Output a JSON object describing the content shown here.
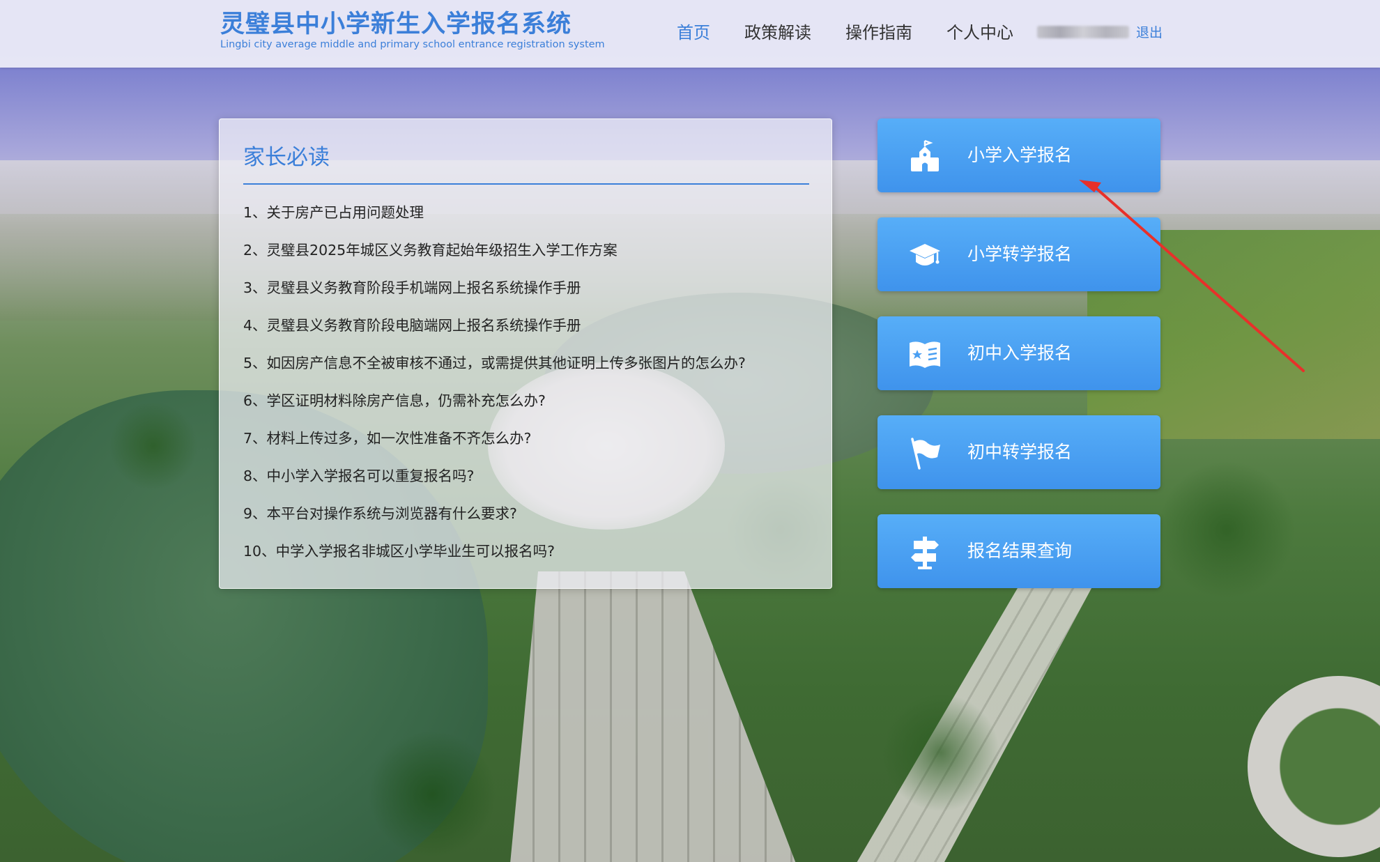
{
  "header": {
    "title_cn": "灵璧县中小学新生入学报名系统",
    "title_en": "Lingbi city average middle and primary school entrance registration system",
    "nav": [
      {
        "label": "首页",
        "active": true
      },
      {
        "label": "政策解读",
        "active": false
      },
      {
        "label": "操作指南",
        "active": false
      },
      {
        "label": "个人中心",
        "active": false
      }
    ],
    "logout_label": "退出"
  },
  "notice": {
    "title": "家长必读",
    "items": [
      "1、关于房产已占用问题处理",
      "2、灵璧县2025年城区义务教育起始年级招生入学工作方案",
      "3、灵璧县义务教育阶段手机端网上报名系统操作手册",
      "4、灵璧县义务教育阶段电脑端网上报名系统操作手册",
      "5、如因房产信息不全被审核不通过，或需提供其他证明上传多张图片的怎么办?",
      "6、学区证明材料除房产信息，仍需补充怎么办?",
      "7、材料上传过多，如一次性准备不齐怎么办?",
      "8、中小学入学报名可以重复报名吗?",
      "9、本平台对操作系统与浏览器有什么要求?",
      "10、中学入学报名非城区小学毕业生可以报名吗?"
    ]
  },
  "actions": [
    {
      "label": "小学入学报名",
      "icon": "school-icon"
    },
    {
      "label": "小学转学报名",
      "icon": "graduation-cap-icon"
    },
    {
      "label": "初中入学报名",
      "icon": "book-star-icon"
    },
    {
      "label": "初中转学报名",
      "icon": "flag-icon"
    },
    {
      "label": "报名结果查询",
      "icon": "signpost-icon"
    }
  ],
  "colors": {
    "accent": "#3b7fd9",
    "button": "#4a9ff2",
    "annotation": "#e8302a"
  }
}
